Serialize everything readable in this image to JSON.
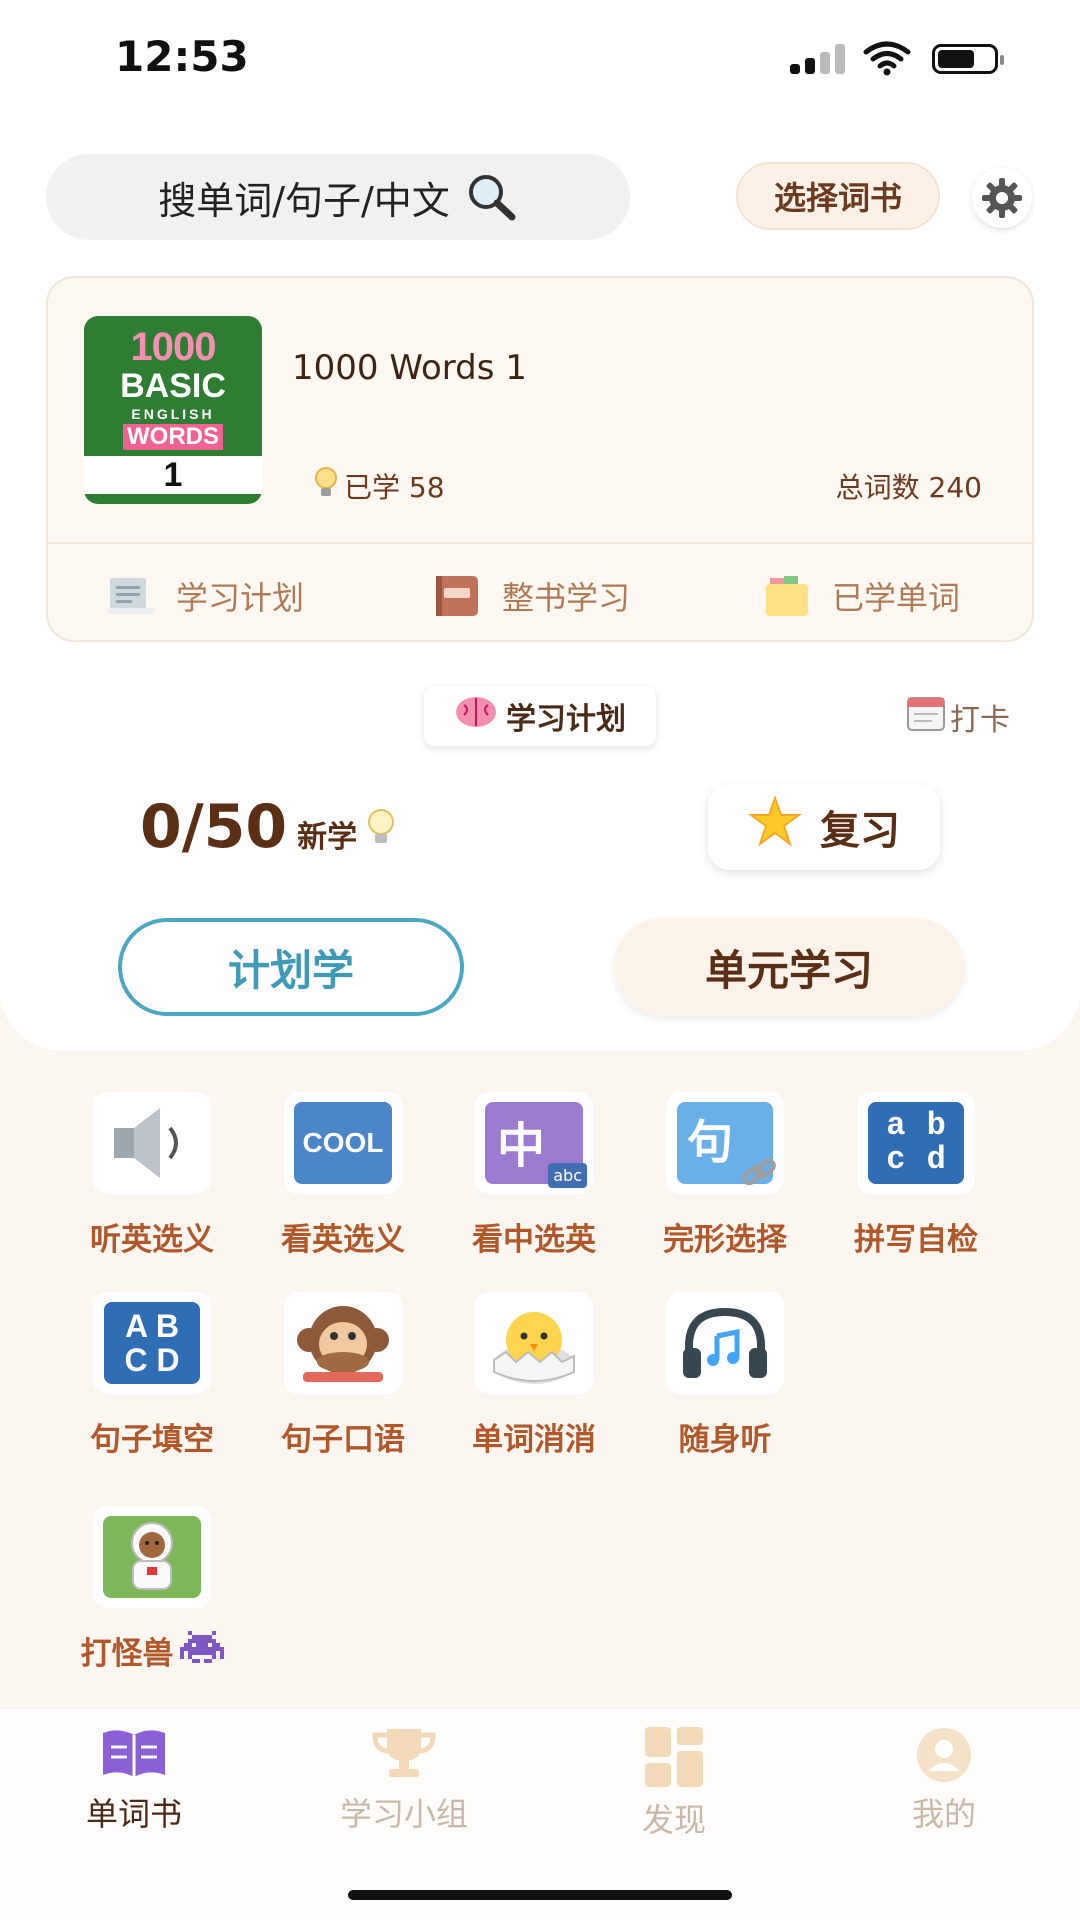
{
  "status_bar": {
    "time": "12:53"
  },
  "search": {
    "placeholder": "搜单词/句子/中文"
  },
  "header": {
    "select_book_label": "选择词书"
  },
  "book": {
    "cover": {
      "line1": "1000",
      "line2": "BASIC",
      "line3": "ENGLISH",
      "line4": "WORDS",
      "line5": "1"
    },
    "title": "1000 Words 1",
    "learned_label": "已学 58",
    "total_label": "总词数 240",
    "actions": [
      {
        "label": "学习计划",
        "icon": "document-icon"
      },
      {
        "label": "整书学习",
        "icon": "book-icon"
      },
      {
        "label": "已学单词",
        "icon": "folder-icon"
      }
    ]
  },
  "plan": {
    "pill_label": "学习计划",
    "checkin_label": "打卡",
    "progress": "0/50",
    "new_label": "新学",
    "review_label": "复习",
    "plan_learn_label": "计划学",
    "unit_learn_label": "单元学习"
  },
  "modes": [
    {
      "label": "听英选义",
      "icon": "speaker-icon"
    },
    {
      "label": "看英选义",
      "icon": "cool-icon",
      "text": "COOL"
    },
    {
      "label": "看中选英",
      "icon": "chinese-abc-icon",
      "text": "中",
      "sub": "abc"
    },
    {
      "label": "完形选择",
      "icon": "sentence-link-icon",
      "text": "句"
    },
    {
      "label": "拼写自检",
      "icon": "abcd-lower-icon",
      "text": "a b c d"
    },
    {
      "label": "句子填空",
      "icon": "abcd-upper-icon",
      "text": "A B C D"
    },
    {
      "label": "句子口语",
      "icon": "monkey-icon"
    },
    {
      "label": "单词消消",
      "icon": "chick-icon"
    },
    {
      "label": "随身听",
      "icon": "headphones-icon"
    },
    {
      "label": "打怪兽",
      "icon": "astronaut-icon"
    }
  ],
  "tabs": [
    {
      "label": "单词书",
      "active": true
    },
    {
      "label": "学习小组",
      "active": false
    },
    {
      "label": "发现",
      "active": false
    },
    {
      "label": "我的",
      "active": false
    }
  ],
  "colors": {
    "accent_blue": "#4aa7c2",
    "brown_text": "#5a2f16",
    "mode_label": "#b0582a",
    "tab_active": "#7b4fc9",
    "tab_inactive": "#c9b8a8",
    "page_bg": "#fbf6f0"
  }
}
